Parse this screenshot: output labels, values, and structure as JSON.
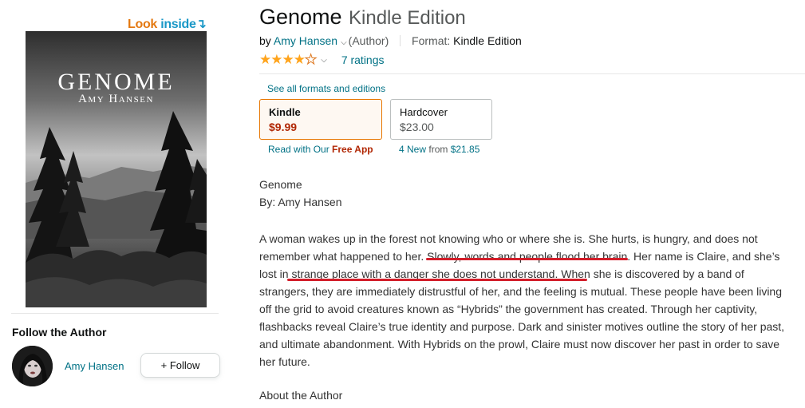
{
  "look_inside": {
    "look": "Look",
    "inside": "inside",
    "arrow": "↴"
  },
  "cover": {
    "title": "GENOME",
    "author": "Amy Hansen"
  },
  "follow": {
    "heading": "Follow the Author",
    "author_name": "Amy Hansen",
    "button_label": "+ Follow"
  },
  "product": {
    "title": "Genome",
    "edition": "Kindle Edition",
    "by_prefix": "by",
    "author": "Amy Hansen",
    "author_role": "(Author)",
    "format_label": "Format:",
    "format_value": "Kindle Edition",
    "rating_stars": 4,
    "ratings_count": "7 ratings"
  },
  "formats": {
    "see_all": "See all formats and editions",
    "kindle": {
      "name": "Kindle",
      "price": "$9.99",
      "note_prefix": "Read with Our",
      "note_bold": "Free App"
    },
    "hardcover": {
      "name": "Hardcover",
      "price": "$23.00",
      "note_link": "4 New",
      "note_from": "from",
      "note_price": "$21.85"
    }
  },
  "description": {
    "title": "Genome",
    "by": "By: Amy Hansen",
    "body_1": "A woman wakes up in the forest not knowing who or where she is. She hurts, is hungry, and does not remember what happened to her.",
    "body_highlight_1": "Slowly, words and people flood her brain",
    "body_2": ". Her name is Claire, and she’s",
    "body_highlight_2": "lost in strange place with a danger she does not understand",
    "body_3": ". When she is discovered by a band of strangers, they are immediately distrustful of her, and the feeling is mutual. These people have been living off the grid to avoid creatures known as “Hybrids” the government has created. Through her captivity, flashbacks reveal Claire’s true identity and purpose. Dark and sinister motives outline the story of her past, and ultimate abandonment. With Hybrids on the prowl, Claire must now discover her past in order to save her future.",
    "about": "About the Author"
  },
  "colors": {
    "link": "#007185",
    "price": "#b12704",
    "star": "#ffa41c",
    "annotation": "#d31e2a",
    "kindle_border": "#e77600"
  }
}
